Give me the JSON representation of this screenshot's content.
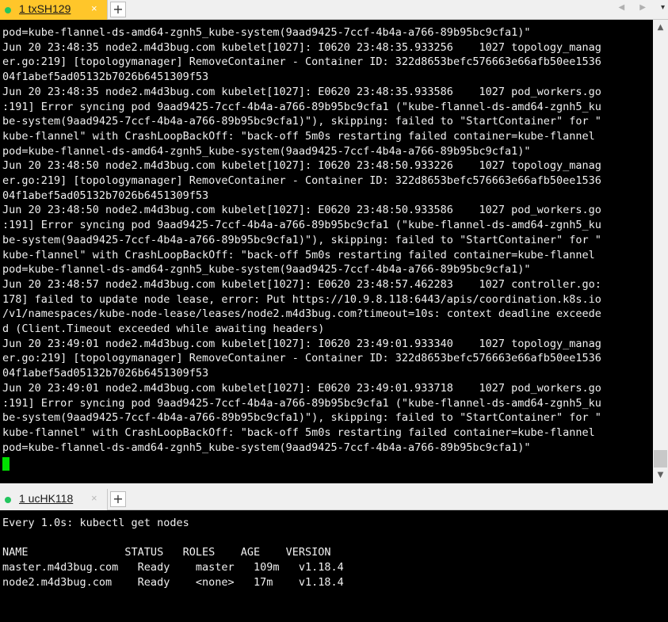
{
  "top_tabs": {
    "active_tab": {
      "label": "1 txSH129",
      "close_icon": "×"
    },
    "new_tab": "+",
    "nav_arrows": "◀ ▶",
    "tab_menu": "▾"
  },
  "top_terminal": {
    "lines": [
      "pod=kube-flannel-ds-amd64-zgnh5_kube-system(9aad9425-7ccf-4b4a-a766-89b95bc9cfa1)\"",
      "Jun 20 23:48:35 node2.m4d3bug.com kubelet[1027]: I0620 23:48:35.933256    1027 topology_manag",
      "er.go:219] [topologymanager] RemoveContainer - Container ID: 322d8653befc576663e66afb50ee1536",
      "04f1abef5ad05132b7026b6451309f53",
      "Jun 20 23:48:35 node2.m4d3bug.com kubelet[1027]: E0620 23:48:35.933586    1027 pod_workers.go",
      ":191] Error syncing pod 9aad9425-7ccf-4b4a-a766-89b95bc9cfa1 (\"kube-flannel-ds-amd64-zgnh5_ku",
      "be-system(9aad9425-7ccf-4b4a-a766-89b95bc9cfa1)\"), skipping: failed to \"StartContainer\" for \"",
      "kube-flannel\" with CrashLoopBackOff: \"back-off 5m0s restarting failed container=kube-flannel",
      "pod=kube-flannel-ds-amd64-zgnh5_kube-system(9aad9425-7ccf-4b4a-a766-89b95bc9cfa1)\"",
      "Jun 20 23:48:50 node2.m4d3bug.com kubelet[1027]: I0620 23:48:50.933226    1027 topology_manag",
      "er.go:219] [topologymanager] RemoveContainer - Container ID: 322d8653befc576663e66afb50ee1536",
      "04f1abef5ad05132b7026b6451309f53",
      "Jun 20 23:48:50 node2.m4d3bug.com kubelet[1027]: E0620 23:48:50.933586    1027 pod_workers.go",
      ":191] Error syncing pod 9aad9425-7ccf-4b4a-a766-89b95bc9cfa1 (\"kube-flannel-ds-amd64-zgnh5_ku",
      "be-system(9aad9425-7ccf-4b4a-a766-89b95bc9cfa1)\"), skipping: failed to \"StartContainer\" for \"",
      "kube-flannel\" with CrashLoopBackOff: \"back-off 5m0s restarting failed container=kube-flannel",
      "pod=kube-flannel-ds-amd64-zgnh5_kube-system(9aad9425-7ccf-4b4a-a766-89b95bc9cfa1)\"",
      "Jun 20 23:48:57 node2.m4d3bug.com kubelet[1027]: E0620 23:48:57.462283    1027 controller.go:",
      "178] failed to update node lease, error: Put https://10.9.8.118:6443/apis/coordination.k8s.io",
      "/v1/namespaces/kube-node-lease/leases/node2.m4d3bug.com?timeout=10s: context deadline exceede",
      "d (Client.Timeout exceeded while awaiting headers)",
      "Jun 20 23:49:01 node2.m4d3bug.com kubelet[1027]: I0620 23:49:01.933340    1027 topology_manag",
      "er.go:219] [topologymanager] RemoveContainer - Container ID: 322d8653befc576663e66afb50ee1536",
      "04f1abef5ad05132b7026b6451309f53",
      "Jun 20 23:49:01 node2.m4d3bug.com kubelet[1027]: E0620 23:49:01.933718    1027 pod_workers.go",
      ":191] Error syncing pod 9aad9425-7ccf-4b4a-a766-89b95bc9cfa1 (\"kube-flannel-ds-amd64-zgnh5_ku",
      "be-system(9aad9425-7ccf-4b4a-a766-89b95bc9cfa1)\"), skipping: failed to \"StartContainer\" for \"",
      "kube-flannel\" with CrashLoopBackOff: \"back-off 5m0s restarting failed container=kube-flannel",
      "pod=kube-flannel-ds-amd64-zgnh5_kube-system(9aad9425-7ccf-4b4a-a766-89b95bc9cfa1)\""
    ]
  },
  "scrollbar": {
    "up": "▲",
    "down": "▼"
  },
  "bottom_tabs": {
    "active_tab": {
      "label": "1 ucHK118",
      "close_icon": "×"
    },
    "new_tab": "+"
  },
  "bottom_terminal": {
    "lines": [
      "Every 1.0s: kubectl get nodes",
      "",
      "NAME               STATUS   ROLES    AGE    VERSION",
      "master.m4d3bug.com   Ready    master   109m   v1.18.4",
      "node2.m4d3bug.com    Ready    <none>   17m    v1.18.4"
    ]
  },
  "colors": {
    "active_tab_bg": "#ffc62a",
    "status_dot": "#22c55e",
    "cursor": "#00e000",
    "terminal_bg": "#000000",
    "terminal_fg": "#f0f0f0"
  }
}
